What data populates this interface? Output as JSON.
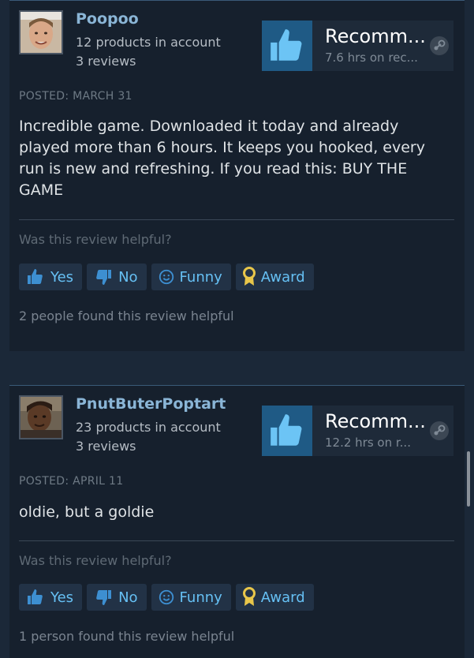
{
  "reviews": [
    {
      "username": "Poopoo",
      "products": "12 products in account",
      "review_count": "3 reviews",
      "recommendation": "Recomm...",
      "hours": "7.6 hrs on rec...",
      "posted": "POSTED: MARCH 31",
      "text": "Incredible game. Downloaded it today and already played more than 6 hours. It keeps you hooked, every run is new and refreshing. If you read this: BUY THE GAME",
      "helpful_question": "Was this review helpful?",
      "buttons": {
        "yes": "Yes",
        "no": "No",
        "funny": "Funny",
        "award": "Award"
      },
      "found_helpful": "2 people found this review helpful"
    },
    {
      "username": "PnutButerPoptart",
      "products": "23 products in account",
      "review_count": "3 reviews",
      "recommendation": "Recomm...",
      "hours": "12.2 hrs on r...",
      "posted": "POSTED: APRIL 11",
      "text": "oldie, but a goldie",
      "helpful_question": "Was this review helpful?",
      "buttons": {
        "yes": "Yes",
        "no": "No",
        "funny": "Funny",
        "award": "Award"
      },
      "found_helpful": "1 person found this review helpful"
    }
  ],
  "colors": {
    "background": "#1b2838",
    "card": "#16202d",
    "accent_link": "#66c0f4",
    "username": "#8ab5d6",
    "thumb_tile": "#1f5a85",
    "award_gold": "#e8c64a"
  },
  "icons": {
    "recommend": "thumbs-up-icon",
    "yes": "thumbs-up-icon",
    "no": "thumbs-down-icon",
    "funny": "smiley-icon",
    "award": "award-ribbon-icon",
    "platform": "steam-icon"
  }
}
